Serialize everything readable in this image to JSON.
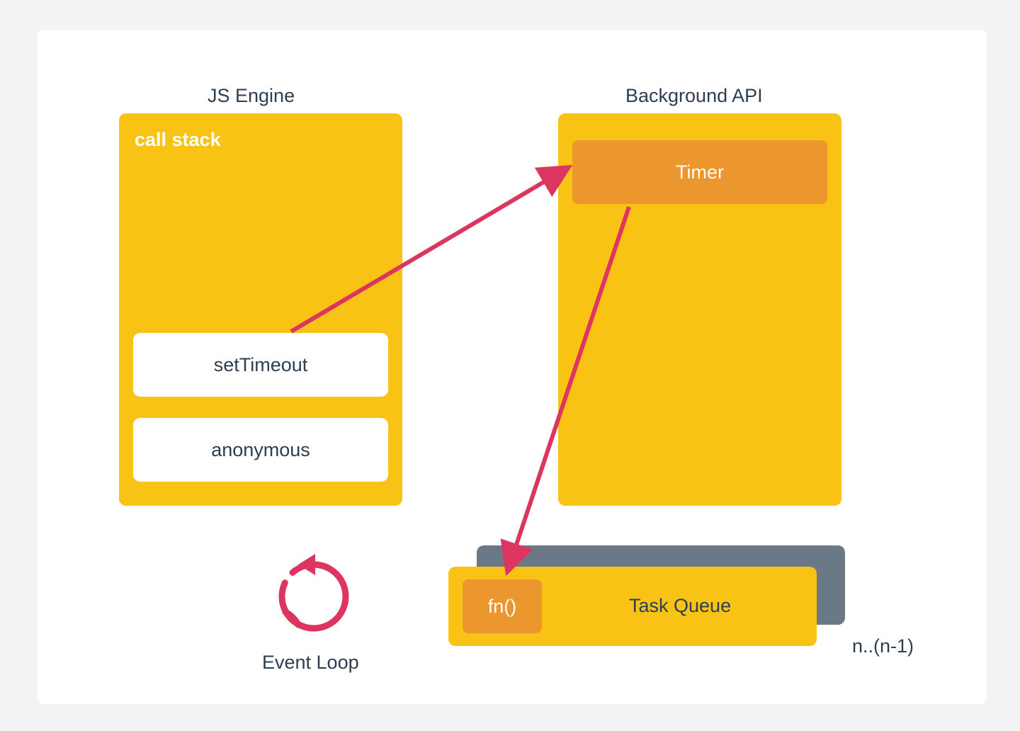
{
  "js_engine": {
    "title": "JS Engine",
    "call_stack_label": "call stack",
    "stack_items": [
      "setTimeout",
      "anonymous"
    ]
  },
  "background_api": {
    "title": "Background API",
    "timer_label": "Timer"
  },
  "event_loop": {
    "label": "Event Loop"
  },
  "task_queue": {
    "fn_label": "fn()",
    "queue_label": "Task Queue",
    "overflow_label": "n..(n-1)"
  },
  "colors": {
    "yellow": "#f9c316",
    "orange": "#ec962e",
    "grey": "#6b7886",
    "red": "#dc3560",
    "text_dark": "#2c3e50"
  }
}
